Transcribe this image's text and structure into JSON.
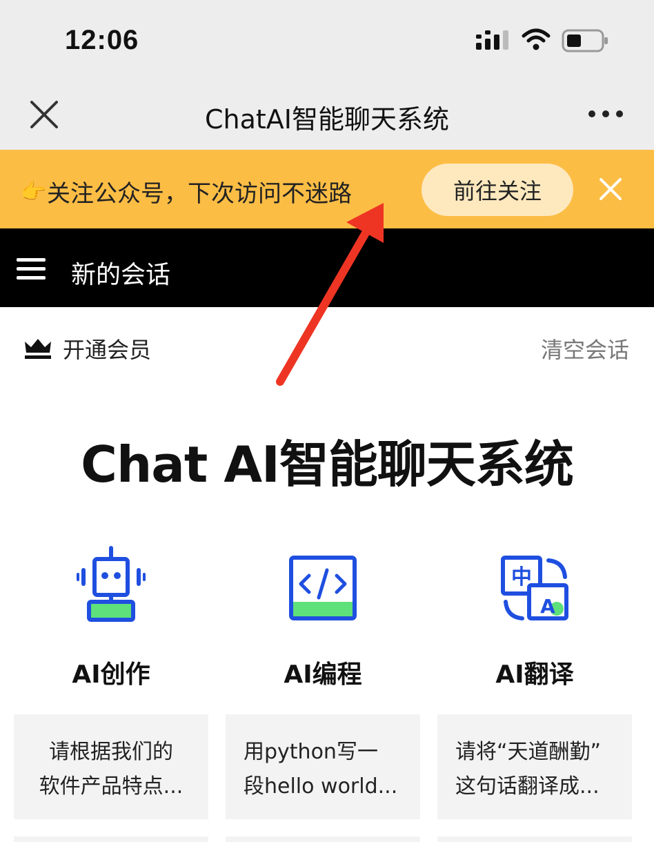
{
  "status": {
    "time": "12:06"
  },
  "nav": {
    "title": "ChatAI智能聊天系统"
  },
  "banner": {
    "hand": "👉",
    "text": "关注公众号，下次访问不迷路",
    "button": "前往关注"
  },
  "header": {
    "title": "新的会话"
  },
  "member": {
    "label": "开通会员",
    "clear": "清空会话"
  },
  "main": {
    "title": "Chat AI智能聊天系统"
  },
  "features": [
    {
      "label": "AI创作",
      "prompt_line1": "请根据我们的",
      "prompt_line2": "软件产品特点..."
    },
    {
      "label": "AI编程",
      "prompt_line1": "用python写一",
      "prompt_line2": "段hello world..."
    },
    {
      "label": "AI翻译",
      "prompt_line1": "请将“天道酬勤”",
      "prompt_line2": "这句话翻译成..."
    }
  ],
  "colors": {
    "banner_bg": "#fcbd45",
    "banner_button_bg": "#fee8be",
    "icon_blue": "#1f4fe0",
    "icon_green": "#5ee07a",
    "arrow_red": "#ee3524"
  },
  "icons": [
    "close-icon",
    "more-icon",
    "hand-pointing-icon",
    "banner-close-icon",
    "menu-icon",
    "crown-icon",
    "robot-icon",
    "code-icon",
    "translate-icon",
    "signal-icon",
    "wifi-icon",
    "battery-icon"
  ]
}
